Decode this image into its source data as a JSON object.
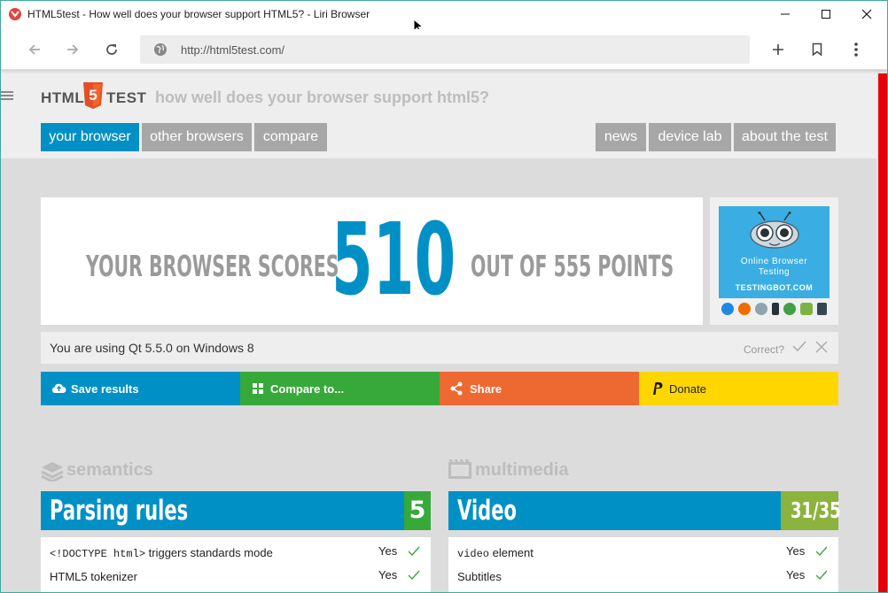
{
  "window": {
    "title": "HTML5test - How well does your browser support HTML5? - Liri Browser",
    "controls": {
      "minimize": "–",
      "maximize": "☐",
      "close": "✕"
    }
  },
  "toolbar": {
    "url": "http://html5test.com/",
    "icons": [
      "back-arrow-icon",
      "forward-arrow-icon",
      "reload-icon",
      "globe-icon",
      "plus-icon",
      "bookmark-icon",
      "more-vert-icon"
    ]
  },
  "site": {
    "logo_left": "HTML",
    "logo_badge": "5",
    "logo_right": "TEST",
    "tagline": "how well does your browser support html5?",
    "nav_left": [
      "your browser",
      "other browsers",
      "compare"
    ],
    "nav_right": [
      "news",
      "device lab",
      "about the test"
    ],
    "active_nav": "your browser"
  },
  "score": {
    "prefix": "YOUR BROWSER SCORES",
    "value": "510",
    "suffix": "OUT OF 555 POINTS"
  },
  "ad": {
    "title_line1": "Online Browser",
    "title_line2": "Testing",
    "url": "TESTINGBOT.COM"
  },
  "detection": {
    "text": "You are using Qt 5.5.0 on Windows 8",
    "correct_label": "Correct?"
  },
  "actions": {
    "save": "Save results",
    "compare": "Compare to...",
    "share": "Share",
    "donate": "Donate"
  },
  "sections": [
    {
      "heading": "semantics",
      "category": "Parsing rules",
      "score": "5",
      "tests": [
        {
          "code": "<!DOCTYPE html>",
          "text": " triggers standards mode",
          "result": "Yes"
        },
        {
          "code": "",
          "text": "HTML5 tokenizer",
          "result": "Yes"
        }
      ]
    },
    {
      "heading": "multimedia",
      "category": "Video",
      "score": "31/35",
      "tests": [
        {
          "code": "video",
          "text": " element",
          "result": "Yes"
        },
        {
          "code": "",
          "text": "Subtitles",
          "result": "Yes"
        }
      ]
    }
  ],
  "colors": {
    "accent_blue": "#0090c6",
    "green": "#37a93a",
    "orange": "#ee6832",
    "yellow": "#ffd600",
    "olive_score": "#8bb33d",
    "scrollbar": "#e8000a"
  }
}
